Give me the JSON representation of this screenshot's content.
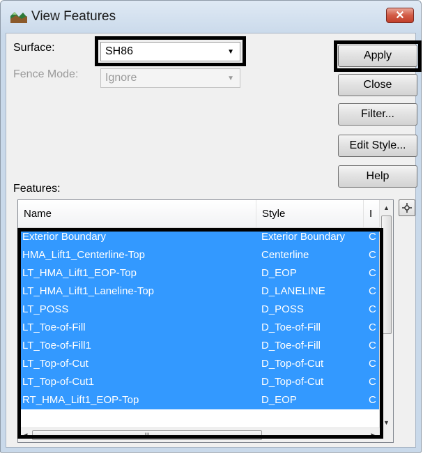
{
  "window": {
    "title": "View Features",
    "close_glyph": "✕"
  },
  "surface": {
    "label": "Surface:",
    "value": "SH86"
  },
  "fence": {
    "label": "Fence Mode:",
    "value": "Ignore"
  },
  "buttons": {
    "apply": "Apply",
    "close": "Close",
    "filter": "Filter...",
    "edit_style": "Edit Style...",
    "help": "Help"
  },
  "features": {
    "label": "Features:",
    "columns": [
      "Name",
      "Style",
      "I"
    ],
    "rows": [
      {
        "name": "Exterior Boundary",
        "style": "Exterior Boundary",
        "col3": "C"
      },
      {
        "name": "HMA_Lift1_Centerline-Top",
        "style": "Centerline",
        "col3": "C"
      },
      {
        "name": "LT_HMA_Lift1_EOP-Top",
        "style": "D_EOP",
        "col3": "C"
      },
      {
        "name": "LT_HMA_Lift1_Laneline-Top",
        "style": "D_LANELINE",
        "col3": "C"
      },
      {
        "name": "LT_POSS",
        "style": "D_POSS",
        "col3": "C"
      },
      {
        "name": "LT_Toe-of-Fill",
        "style": "D_Toe-of-Fill",
        "col3": "C"
      },
      {
        "name": "LT_Toe-of-Fill1",
        "style": "D_Toe-of-Fill",
        "col3": "C"
      },
      {
        "name": "LT_Top-of-Cut",
        "style": "D_Top-of-Cut",
        "col3": "C"
      },
      {
        "name": "LT_Top-of-Cut1",
        "style": "D_Top-of-Cut",
        "col3": "C"
      },
      {
        "name": "RT_HMA_Lift1_EOP-Top",
        "style": "D_EOP",
        "col3": "C"
      }
    ]
  },
  "colors": {
    "selection": "#3399ff",
    "highlight_box": "#000000"
  }
}
